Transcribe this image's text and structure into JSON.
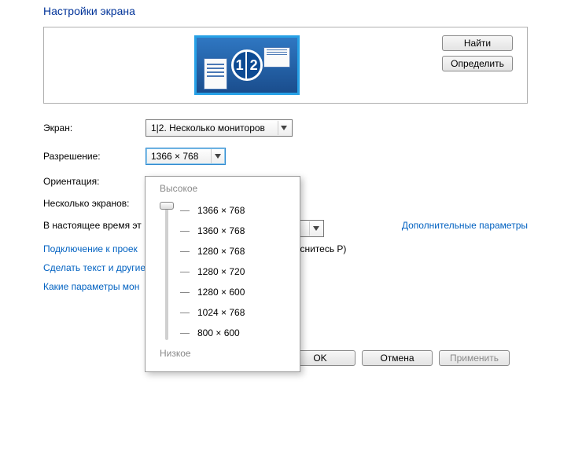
{
  "title": "Настройки экрана",
  "buttons": {
    "find": "Найти",
    "identify": "Определить",
    "ok": "OK",
    "cancel": "Отмена",
    "apply": "Применить"
  },
  "labels": {
    "screen": "Экран:",
    "resolution": "Разрешение:",
    "orientation": "Ориентация:",
    "multiple": "Несколько экранов:"
  },
  "dropdowns": {
    "screen_value": "1|2. Несколько мониторов",
    "resolution_value": "1366 × 768"
  },
  "monitors": {
    "left": "1",
    "right": "2"
  },
  "resolution_popup": {
    "high": "Высокое",
    "low": "Низкое",
    "options": [
      "1366 × 768",
      "1360 × 768",
      "1280 × 768",
      "1280 × 720",
      "1280 × 600",
      "1024 × 768",
      "800 × 600"
    ]
  },
  "text": {
    "currently": "В настоящее время эт",
    "advanced_params": "Дополнительные параметры",
    "projector_link": "Подключение к проек",
    "projector_tail": "оснитесь P)",
    "textsize_link": "Сделать текст и другие",
    "which_params": "Какие параметры мон"
  }
}
